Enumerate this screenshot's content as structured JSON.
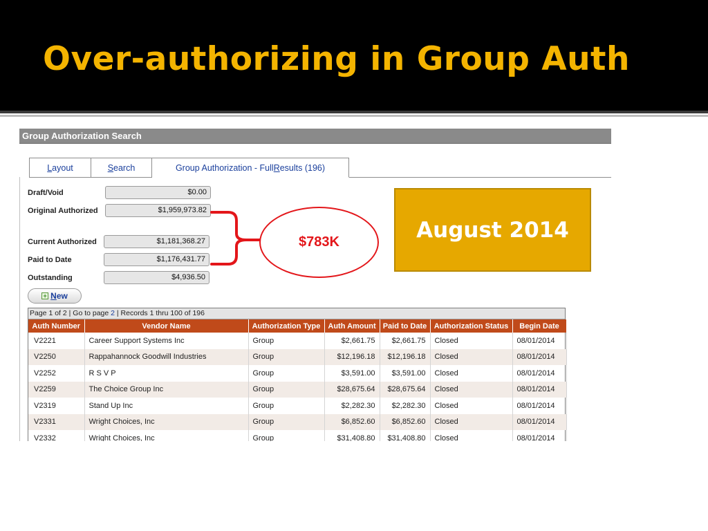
{
  "slide": {
    "title": "Over-authorizing in Group Auth"
  },
  "app": {
    "header_title": "Group Authorization Search",
    "tabs": [
      {
        "pre": "",
        "key": "L",
        "post": "ayout"
      },
      {
        "pre": "",
        "key": "S",
        "post": "earch"
      },
      {
        "pre": "Group Authorization - Full ",
        "key": "R",
        "post": "esults (196)"
      }
    ],
    "summary": {
      "draft_void": {
        "label": "Draft/Void",
        "value": "$0.00"
      },
      "original_authorized": {
        "label": "Original Authorized",
        "value": "$1,959,973.82"
      },
      "current_authorized": {
        "label": "Current Authorized",
        "value": "$1,181,368.27"
      },
      "paid_to_date": {
        "label": "Paid to Date",
        "value": "$1,176,431.77"
      },
      "outstanding": {
        "label": "Outstanding",
        "value": "$4,936.50"
      }
    },
    "new_button": {
      "key": "N",
      "post": "ew"
    },
    "pager": {
      "text1": "Page 1 of 2 | Go to page ",
      "page_link": "2",
      "text2": " | Records 1 thru 100 of 196"
    },
    "grid": {
      "columns": [
        "Auth Number",
        "Vendor Name",
        "Authorization Type",
        "Auth Amount",
        "Paid to Date",
        "Authorization Status",
        "Begin Date"
      ],
      "rows": [
        [
          "V2221",
          "Career Support Systems Inc",
          "Group",
          "$2,661.75",
          "$2,661.75",
          "Closed",
          "08/01/2014"
        ],
        [
          "V2250",
          "Rappahannock Goodwill Industries",
          "Group",
          "$12,196.18",
          "$12,196.18",
          "Closed",
          "08/01/2014"
        ],
        [
          "V2252",
          "R S V P",
          "Group",
          "$3,591.00",
          "$3,591.00",
          "Closed",
          "08/01/2014"
        ],
        [
          "V2259",
          "The Choice Group Inc",
          "Group",
          "$28,675.64",
          "$28,675.64",
          "Closed",
          "08/01/2014"
        ],
        [
          "V2319",
          "Stand Up Inc",
          "Group",
          "$2,282.30",
          "$2,282.30",
          "Closed",
          "08/01/2014"
        ],
        [
          "V2331",
          "Wright Choices, Inc",
          "Group",
          "$6,852.60",
          "$6,852.60",
          "Closed",
          "08/01/2014"
        ],
        [
          "V2332",
          "Wright Choices, Inc",
          "Group",
          "$31,408.80",
          "$31,408.80",
          "Closed",
          "08/01/2014"
        ]
      ]
    }
  },
  "callouts": {
    "difference": "$783K",
    "period": "August 2014",
    "accent_color": "#e3161a",
    "box_color": "#e6a800"
  }
}
